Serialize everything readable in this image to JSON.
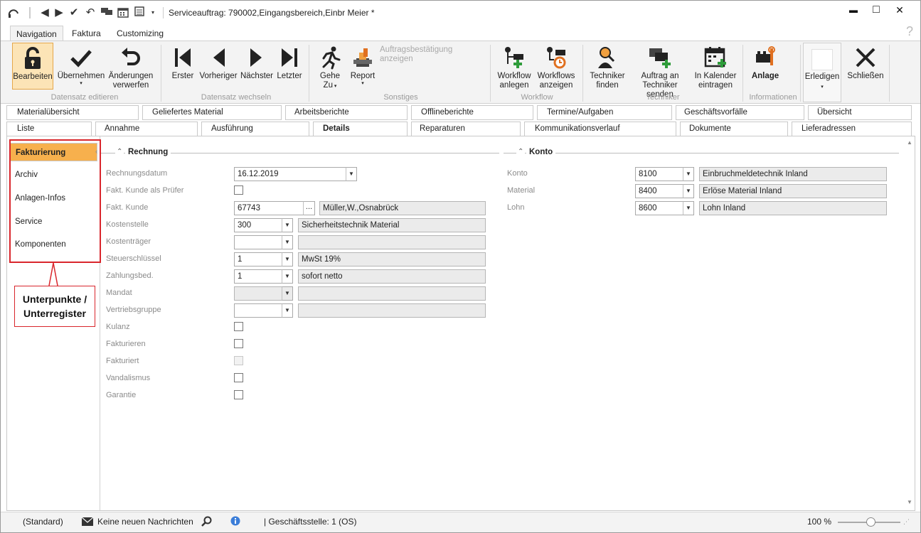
{
  "window": {
    "title": "Serviceauftrag: 790002,Eingangsbereich,Einbr Meier *",
    "minimize": "▬",
    "maximize": "□",
    "close": "✕"
  },
  "ribbon_tabs": [
    "Navigation",
    "Faktura",
    "Customizing"
  ],
  "help": "?",
  "ribbon": {
    "bearbeiten": "Bearbeiten",
    "uebernehmen": "Übernehmen",
    "aenderungen": "Änderungen",
    "verwerfen": "verwerfen",
    "group_datensatz_editieren": "Datensatz editieren",
    "erster": "Erster",
    "vorheriger": "Vorheriger",
    "naechster": "Nächster",
    "letzter": "Letzter",
    "group_datensatz_wechseln": "Datensatz wechseln",
    "gehe": "Gehe",
    "zu": "Zu",
    "report": "Report",
    "auftragsbestaetigung": "Auftragsbestätigung anzeigen",
    "group_sonstiges": "Sonstiges",
    "workflow_anlegen_1": "Workflow",
    "workflow_anlegen_2": "anlegen",
    "workflows_anzeigen_1": "Workflows",
    "workflows_anzeigen_2": "anzeigen",
    "group_workflow": "Workflow",
    "techniker_finden_1": "Techniker",
    "techniker_finden_2": "finden",
    "auftrag_senden_1": "Auftrag an",
    "auftrag_senden_2": "Techniker senden",
    "kalender_1": "In Kalender",
    "kalender_2": "eintragen",
    "group_techniker": "Techniker",
    "anlage": "Anlage",
    "group_informationen": "Informationen",
    "erledigen": "Erledigen",
    "schliessen": "Schließen"
  },
  "tabs_row1": [
    "Materialübersicht",
    "Geliefertes Material",
    "Arbeitsberichte",
    "Offlineberichte",
    "Termine/Aufgaben",
    "Geschäftsvorfälle",
    "Übersicht"
  ],
  "tabs_row2": [
    "Liste",
    "Annahme",
    "Ausführung",
    "Details",
    "Reparaturen",
    "Kommunikationsverlauf",
    "Dokumente",
    "Lieferadressen"
  ],
  "leftnav": [
    "Fakturierung",
    "Archiv",
    "Anlagen-Infos",
    "Service",
    "Komponenten"
  ],
  "callout": {
    "line1": "Unterpunkte /",
    "line2": "Unterregister"
  },
  "rechnung": {
    "title": "Rechnung",
    "rechnungsdatum_label": "Rechnungsdatum",
    "rechnungsdatum": "16.12.2019",
    "fakt_kunde_pruefer_label": "Fakt. Kunde als Prüfer",
    "fakt_kunde_label": "Fakt. Kunde",
    "fakt_kunde": "67743",
    "fakt_kunde_btn": "...",
    "fakt_kunde_name": "Müller,W.,Osnabrück",
    "kostenstelle_label": "Kostenstelle",
    "kostenstelle": "300",
    "kostenstelle_text": "Sicherheitstechnik Material",
    "kostentraeger_label": "Kostenträger",
    "steuerschluessel_label": "Steuerschlüssel",
    "steuerschluessel": "1",
    "steuerschluessel_text": "MwSt 19%",
    "zahlungsbed_label": "Zahlungsbed.",
    "zahlungsbed": "1",
    "zahlungsbed_text": "sofort netto",
    "mandat_label": "Mandat",
    "vertriebsgruppe_label": "Vertriebsgruppe",
    "kulanz_label": "Kulanz",
    "fakturieren_label": "Fakturieren",
    "fakturiert_label": "Fakturiert",
    "vandalismus_label": "Vandalismus",
    "garantie_label": "Garantie"
  },
  "konto": {
    "title": "Konto",
    "konto_label": "Konto",
    "konto": "8100",
    "konto_text": "Einbruchmeldetechnik Inland",
    "material_label": "Material",
    "material": "8400",
    "material_text": "Erlöse Material Inland",
    "lohn_label": "Lohn",
    "lohn": "8600",
    "lohn_text": "Lohn Inland"
  },
  "status": {
    "standard": "(Standard)",
    "nachrichten": "Keine neuen Nachrichten",
    "geschaeftsstelle": "| Geschäftsstelle:  1 (OS)",
    "zoom": "100 %"
  },
  "colors": {
    "accent": "#f7b04d",
    "highlight": "#d9262c"
  }
}
